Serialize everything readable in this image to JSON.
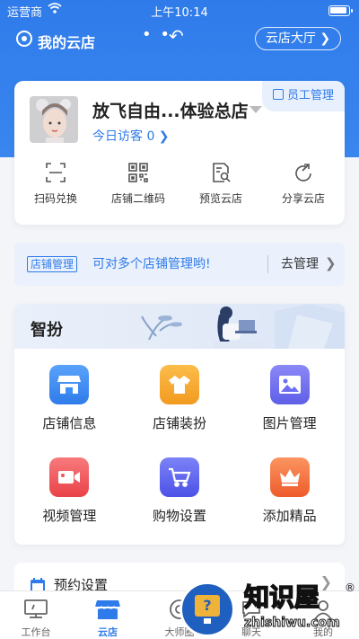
{
  "status_bar": {
    "carrier": "运营商",
    "time": "上午10:14"
  },
  "nav": {
    "title": "我的云店",
    "store_hall": "云店大厅 ❯"
  },
  "store_card": {
    "staff_button": "员工管理",
    "store_name": "放飞自由...体验总店",
    "visitors_label": "今日访客 0 ❯",
    "actions": [
      {
        "label": "扫码兑换",
        "icon": "scan-icon"
      },
      {
        "label": "店铺二维码",
        "icon": "qrcode-icon"
      },
      {
        "label": "预览云店",
        "icon": "preview-icon"
      },
      {
        "label": "分享云店",
        "icon": "share-icon"
      }
    ]
  },
  "banner": {
    "tag": "店铺管理",
    "message": "可对多个店铺管理哟!",
    "action": "去管理"
  },
  "decoration": {
    "title": "智扮",
    "items": [
      {
        "label": "店铺信息",
        "icon": "store-icon",
        "color": "#3d8ef7"
      },
      {
        "label": "店铺装扮",
        "icon": "shirt-icon",
        "color": "#f5a431"
      },
      {
        "label": "图片管理",
        "icon": "image-icon",
        "color": "#6b6ef2"
      },
      {
        "label": "视频管理",
        "icon": "video-icon",
        "color": "#f0555a"
      },
      {
        "label": "购物设置",
        "icon": "cart-icon",
        "color": "#5d63ee"
      },
      {
        "label": "添加精品",
        "icon": "crown-icon",
        "color": "#f46b3d"
      }
    ]
  },
  "reservation": {
    "label": "预约设置"
  },
  "tabbar": {
    "tabs": [
      {
        "label": "工作台",
        "icon": "monitor-icon"
      },
      {
        "label": "云店",
        "icon": "store-tab-icon"
      },
      {
        "label": "大师圈",
        "icon": "circle-tab-icon"
      },
      {
        "label": "聊天",
        "icon": "chat-icon"
      },
      {
        "label": "我的",
        "icon": "user-icon"
      }
    ]
  },
  "watermark": {
    "brand": "知识屋",
    "url": "zhishiwu.com",
    "reg": "®"
  },
  "colors": {
    "primary": "#2f7bea",
    "background": "#f3f5f9"
  }
}
